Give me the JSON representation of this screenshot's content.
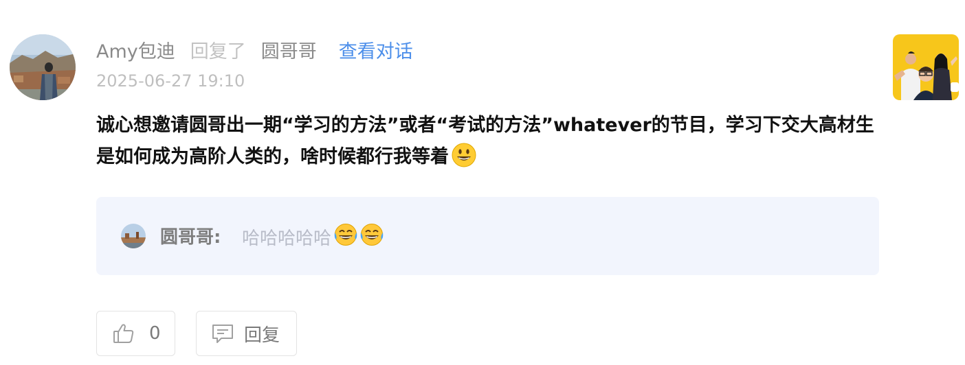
{
  "comment": {
    "author": "Amy包迪",
    "replied_label": "回复了",
    "reply_target": "圆哥哥",
    "view_conversation": "查看对话",
    "timestamp": "2025-06-27 19:10",
    "body": "诚心想邀请圆哥出一期“学习的方法”或者“考试的方法”whatever的节目，学习下交大高材生是如何成为高阶人类的，啥时候都行我等着",
    "trailing_emoji": "smiley-emoji"
  },
  "quoted_reply": {
    "author": "圆哥哥:",
    "text": "哈哈哈哈哈",
    "emojis": [
      "tears-of-joy-emoji",
      "tears-of-joy-emoji"
    ]
  },
  "actions": {
    "like_count": "0",
    "reply_label": "回复"
  },
  "icons": {
    "like": "thumbs-up-icon",
    "reply": "comment-bubble-icon"
  },
  "colors": {
    "link": "#4d8fea",
    "quote_background": "#f2f5fd",
    "thumbnail_background": "#f7c61b"
  }
}
